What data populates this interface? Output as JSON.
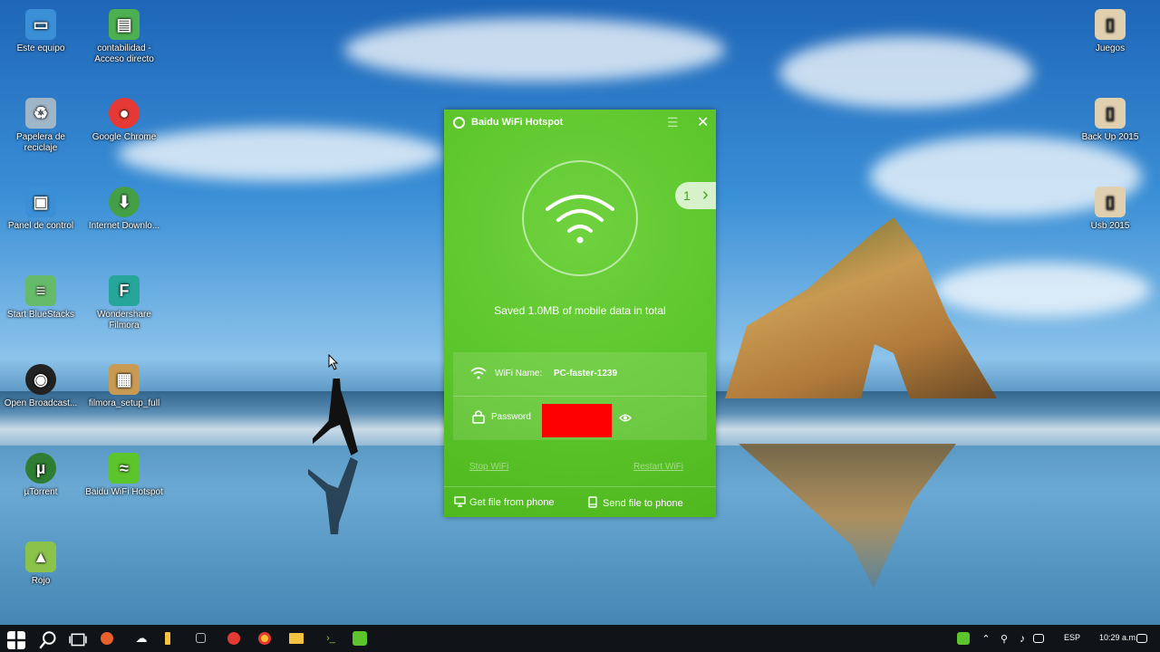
{
  "desktop": {
    "icons_left": [
      {
        "label": "Este equipo",
        "color": "#3a8fd6",
        "symbol": "computer-icon"
      },
      {
        "label": "contabilidad - Acceso directo",
        "color": "#4caf50",
        "symbol": "shortcut-icon"
      },
      {
        "label": "Papelera de reciclaje",
        "color": "#9fb6c9",
        "symbol": "recycle-bin-icon"
      },
      {
        "label": "Google Chrome",
        "color": "#e53935",
        "symbol": "chrome-icon"
      },
      {
        "label": "Panel de control",
        "color": "#3a8fd6",
        "symbol": "control-panel-icon"
      },
      {
        "label": "Internet Downlo...",
        "color": "#43a047",
        "symbol": "idm-icon"
      },
      {
        "label": "Start BlueStacks",
        "color": "#66bb6a",
        "symbol": "bluestacks-icon"
      },
      {
        "label": "Wondershare Filmora",
        "color": "#26a69a",
        "symbol": "filmora-icon"
      },
      {
        "label": "Open Broadcast...",
        "color": "#222222",
        "symbol": "obs-icon"
      },
      {
        "label": "filmora_setup_full",
        "color": "#c89a52",
        "symbol": "setup-icon"
      },
      {
        "label": "µTorrent",
        "color": "#2e7d32",
        "symbol": "utorrent-icon"
      },
      {
        "label": "Baidu WiFi Hotspot",
        "color": "#5cc52b",
        "symbol": "wifi-icon"
      },
      {
        "label": "Rojo",
        "color": "#8bc34a",
        "symbol": "rojo-icon"
      }
    ],
    "icons_right": [
      {
        "label": "Juegos",
        "color": "#e0d0b0",
        "symbol": "folder-icon"
      },
      {
        "label": "Back Up 2015",
        "color": "#e0d0b0",
        "symbol": "folder-icon"
      },
      {
        "label": "Usb 2015",
        "color": "#e0d0b0",
        "symbol": "folder-icon"
      }
    ]
  },
  "app": {
    "title": "Baidu WiFi Hotspot",
    "menu_glyph": "☰",
    "close_glyph": "✕",
    "device_count": "1",
    "pager_arrow": "›",
    "saved_text": "Saved 1.0MB of mobile data in total",
    "wifi_name_label": "WiFi Name:",
    "wifi_name_value": "PC-faster-1239",
    "password_label": "Password",
    "stop_wifi": "Stop WiFi",
    "restart_wifi": "Restart WiFi",
    "get_file": "Get file from phone",
    "send_file": "Send file to phone",
    "accent": "#5cc52b"
  },
  "taskbar": {
    "language": "ESP",
    "time": "10:29 a.m."
  }
}
